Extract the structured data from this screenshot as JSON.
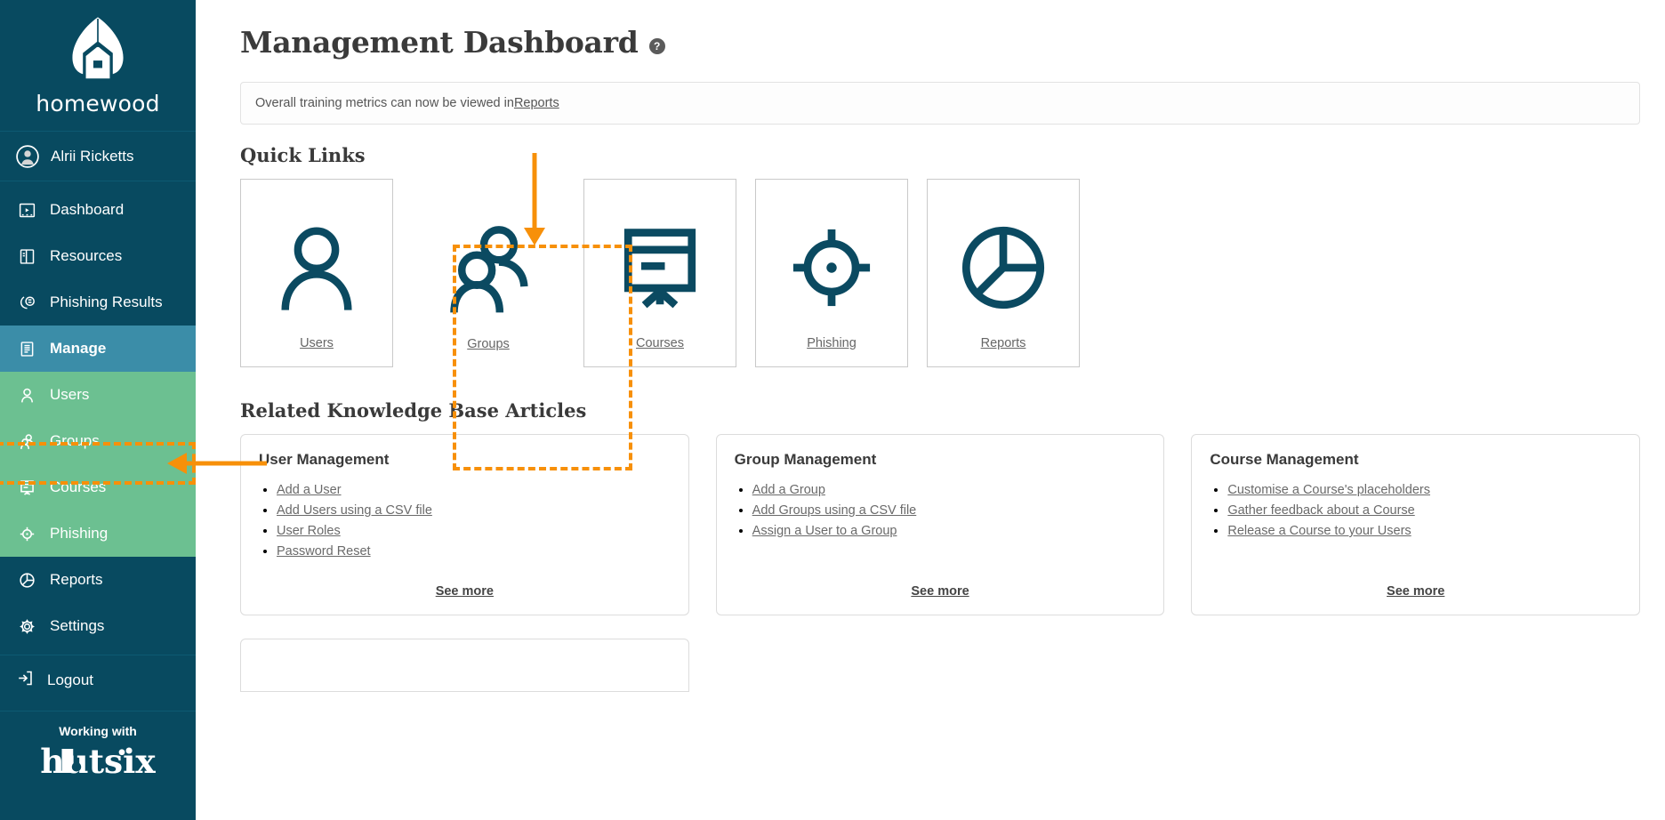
{
  "sidebar": {
    "brand": {
      "wordmark": "homewood",
      "logo_icon": "homewood-leaf-house-logo"
    },
    "user": {
      "name": "Alrii Ricketts",
      "avatar_icon": "user-avatar-icon"
    },
    "items": [
      {
        "label": "Dashboard",
        "icon": "dashboard-screen-icon",
        "state": "default"
      },
      {
        "label": "Resources",
        "icon": "book-resources-icon",
        "state": "default"
      },
      {
        "label": "Phishing Results",
        "icon": "phishing-hook-icon",
        "state": "default"
      },
      {
        "label": "Manage",
        "icon": "manage-list-icon",
        "state": "active"
      },
      {
        "label": "Users",
        "icon": "user-icon",
        "state": "sub"
      },
      {
        "label": "Groups",
        "icon": "groups-icon",
        "state": "sub-highlighted"
      },
      {
        "label": "Courses",
        "icon": "courses-projector-icon",
        "state": "sub"
      },
      {
        "label": "Phishing",
        "icon": "phishing-target-icon",
        "state": "sub"
      },
      {
        "label": "Reports",
        "icon": "reports-pie-icon",
        "state": "default"
      },
      {
        "label": "Settings",
        "icon": "settings-gear-icon",
        "state": "default"
      }
    ],
    "logout": {
      "label": "Logout",
      "icon": "logout-arrow-icon"
    },
    "footer": {
      "working_with": "Working with",
      "partner_logo": "hutsix"
    }
  },
  "header": {
    "title": "Management Dashboard",
    "help_icon": "help-question-icon",
    "help_glyph": "?"
  },
  "notice": {
    "text_before": "Overall training metrics can now be viewed in ",
    "link": "Reports"
  },
  "quick_links": {
    "heading": "Quick Links",
    "cards": [
      {
        "label": "Users",
        "icon": "single-person-icon",
        "highlighted": false
      },
      {
        "label": "Groups",
        "icon": "two-people-group-icon",
        "highlighted": true
      },
      {
        "label": "Courses",
        "icon": "projector-screen-icon",
        "highlighted": false
      },
      {
        "label": "Phishing",
        "icon": "crosshair-target-icon",
        "highlighted": false
      },
      {
        "label": "Reports",
        "icon": "pie-chart-icon",
        "highlighted": false
      }
    ]
  },
  "knowledge_base": {
    "heading": "Related Knowledge Base Articles",
    "see_more_label": "See more",
    "cards": [
      {
        "title": "User Management",
        "links": [
          "Add a User",
          "Add Users using a CSV file",
          "User Roles",
          "Password Reset"
        ]
      },
      {
        "title": "Group Management",
        "links": [
          "Add a Group",
          "Add Groups using a CSV file",
          "Assign a User to a Group"
        ]
      },
      {
        "title": "Course Management",
        "links": [
          "Customise a Course's placeholders",
          "Gather feedback about a Course",
          "Release a Course to your Users"
        ]
      }
    ]
  },
  "colors": {
    "sidebar_bg": "#084A60",
    "sidebar_active": "#3B8DA8",
    "sidebar_sub": "#6CC091",
    "icon_teal": "#0B4A61",
    "annotation_orange": "#F79009"
  }
}
